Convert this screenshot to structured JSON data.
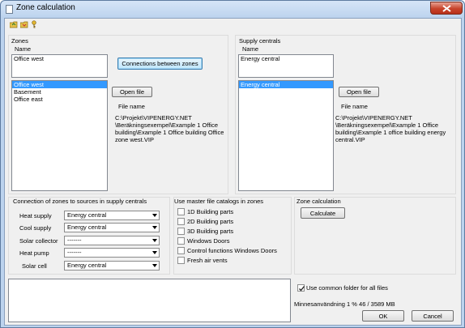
{
  "window": {
    "title": "Zone calculation"
  },
  "toolbar": {
    "icons": [
      "open-folder-icon",
      "save-folder-icon",
      "key-icon"
    ]
  },
  "zones": {
    "group_label": "Zones",
    "name_header": "Name",
    "name_value": "Office west",
    "connections_button": "Connections between zones",
    "list": [
      "Office west",
      "Basement",
      "Office east"
    ],
    "selected_index": 0,
    "open_file_button": "Open file",
    "file_name_label": "File name",
    "file_path": "C:\\Projekt\\VIPENERGY.NET \\Beräkningsexempel\\Example 1 Office building\\Example 1 Office building Office zone west.VIP"
  },
  "supply": {
    "group_label": "Supply centrals",
    "name_header": "Name",
    "name_value": "Energy central",
    "list": [
      "Energy central"
    ],
    "selected_index": 0,
    "open_file_button": "Open file",
    "file_name_label": "File name",
    "file_path": "C:\\Projekt\\VIPENERGY.NET \\Beräkningsexempel\\Example 1 Office building\\Example 1 office building energy central.VIP"
  },
  "connection": {
    "group_label": "Connection of zones to sources in supply centrals",
    "rows": [
      {
        "label": "Heat supply",
        "value": "Energy central"
      },
      {
        "label": "Cool supply",
        "value": "Energy central"
      },
      {
        "label": "Solar collector",
        "value": "-------"
      },
      {
        "label": "Heat pump",
        "value": "-------"
      },
      {
        "label": "Solar cell",
        "value": "Energy central"
      }
    ]
  },
  "master": {
    "group_label": "Use master file catalogs in zones",
    "items": [
      {
        "label": "1D Building parts",
        "checked": false
      },
      {
        "label": "2D Building parts",
        "checked": false
      },
      {
        "label": "3D Building parts",
        "checked": false
      },
      {
        "label": "Windows Doors",
        "checked": false
      },
      {
        "label": "Control functions Windows Doors",
        "checked": false
      },
      {
        "label": "Fresh air vents",
        "checked": false
      }
    ]
  },
  "calc": {
    "group_label": "Zone calculation",
    "calculate_button": "Calculate"
  },
  "footer": {
    "common_folder_label": "Use common folder for all files",
    "common_folder_checked": true,
    "memory_text": "Minnesanvändning 1 %   46 / 3589 MB",
    "ok_button": "OK",
    "cancel_button": "Cancel"
  }
}
